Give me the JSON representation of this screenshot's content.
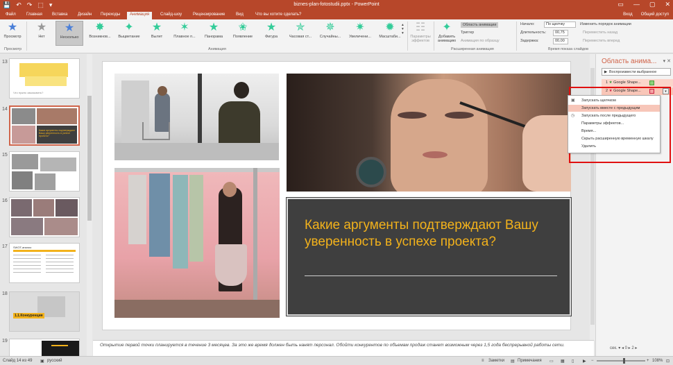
{
  "titlebar": {
    "title": "biznes-plan-fotostudii.pptx - PowerPoint",
    "qat": [
      "💾",
      "↶",
      "↷",
      "⬚",
      "▾"
    ],
    "winbtns": [
      "▭",
      "—",
      "▢",
      "✕"
    ]
  },
  "tabs": [
    {
      "label": "Файл"
    },
    {
      "label": "Главная"
    },
    {
      "label": "Вставка"
    },
    {
      "label": "Дизайн"
    },
    {
      "label": "Переходы"
    },
    {
      "label": "Анимация",
      "active": true
    },
    {
      "label": "Слайд-шоу"
    },
    {
      "label": "Рецензирование"
    },
    {
      "label": "Вид"
    },
    {
      "label": "Что вы хотите сделать?"
    }
  ],
  "user": {
    "signin": "Вход",
    "share": "Общий доступ"
  },
  "ribbon": {
    "preview_label": "Просмотр",
    "preview_group": "Просмотр",
    "effects": [
      "Нет",
      "Несколько",
      "Возникнов...",
      "Выцветание",
      "Вылет",
      "Плавное п...",
      "Панорама",
      "Появление",
      "Фигура",
      "Часовая ст...",
      "Случайны...",
      "Увеличени...",
      "Масштаби..."
    ],
    "anim_group": "Анимация",
    "effect_params": "Параметры эффектов",
    "add_anim": "Добавить анимацию",
    "anim_area": "Область анимации",
    "trigger": "Триггер",
    "anim_painter": "Анимация по образцу",
    "adv_group": "Расширенная анимация",
    "start_label": "Начало:",
    "start_value": "По щелчку",
    "duration_label": "Длительность:",
    "duration_value": "00,75",
    "delay_label": "Задержка:",
    "delay_value": "00,00",
    "reorder_title": "Изменить порядок анимации",
    "move_earlier": "Переместить назад",
    "move_later": "Переместить вперед",
    "timing_group": "Время показа слайдов"
  },
  "thumbnails": [
    {
      "num": "13",
      "caption": "Что нужно заказывать?"
    },
    {
      "num": "14",
      "caption": "Какие аргументы подтверждают Вашу уверенность в успехе проекта?"
    },
    {
      "num": "15",
      "caption": ""
    },
    {
      "num": "16",
      "caption": ""
    },
    {
      "num": "17",
      "caption": "SWOT-анализ"
    },
    {
      "num": "18",
      "caption": "1.1.Конкуренция"
    },
    {
      "num": "19",
      "caption": ""
    }
  ],
  "slide": {
    "headline": "Какие аргументы подтверждают Вашу уверенность в успехе проекта?"
  },
  "notes": {
    "text": "Открытие первой точки планируется в течение 3 месяцев. За это же время должен быть нанят персонал. Обойти конкурентов по объемам продаж станет возможным через 1,5 года беспрерывной работы сети."
  },
  "anim_pane": {
    "title": "Область анима...",
    "play": "Воспроизвести выбранное",
    "items": [
      {
        "num": "1",
        "label": "Google Shape..."
      },
      {
        "num": "2",
        "label": "Google Shape..."
      }
    ],
    "bottom": "сек. ▾   ◂  0  ▸  2  ▸"
  },
  "context_menu": {
    "items": [
      {
        "icon": "▣",
        "label": "Запускать щелчком"
      },
      {
        "icon": "",
        "label": "Запускать вместе с предыдущим"
      },
      {
        "icon": "◷",
        "label": "Запускать после предыдущего"
      },
      {
        "icon": "",
        "label": "Параметры эффектов..."
      },
      {
        "icon": "",
        "label": "Время..."
      },
      {
        "icon": "",
        "label": "Скрыть расширенную временную шкалу"
      },
      {
        "icon": "",
        "label": "Удалить"
      }
    ]
  },
  "statusbar": {
    "slide": "Слайд 14 из 49",
    "lang": "русский",
    "notes_btn": "Заметки",
    "comments_btn": "Примечания",
    "zoom": "108%"
  }
}
